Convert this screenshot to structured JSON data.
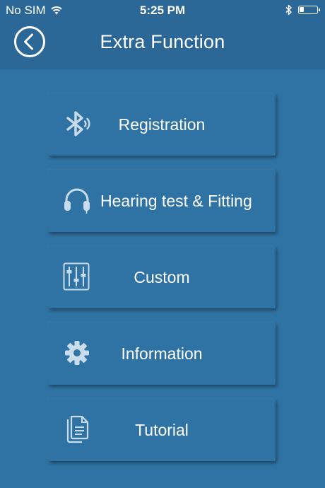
{
  "status_bar": {
    "carrier": "No SIM",
    "time": "5:25 PM",
    "battery_level": 0.25,
    "icons": [
      "wifi-icon",
      "bluetooth-icon",
      "battery-icon"
    ]
  },
  "header": {
    "title": "Extra Function",
    "back_icon": "chevron-left-circle-icon"
  },
  "menu": {
    "items": [
      {
        "label": "Registration",
        "icon": "bluetooth-icon"
      },
      {
        "label": "Hearing test & Fitting",
        "icon": "headphones-icon"
      },
      {
        "label": "Custom",
        "icon": "equalizer-sliders-icon"
      },
      {
        "label": "Information",
        "icon": "gear-icon"
      },
      {
        "label": "Tutorial",
        "icon": "documents-icon"
      }
    ]
  },
  "colors": {
    "background": "#2f73a4",
    "bar": "#2b6897",
    "icon_tint": "#c9dcec",
    "text": "#ffffff"
  }
}
